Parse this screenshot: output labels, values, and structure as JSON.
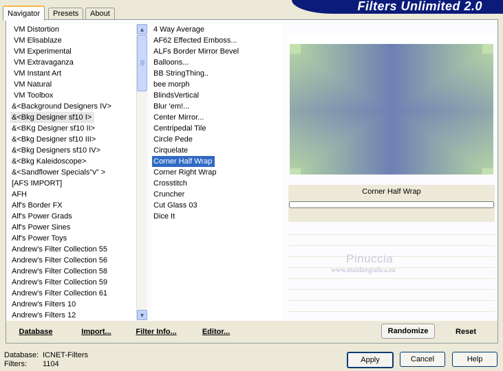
{
  "tabs": [
    {
      "label": "Navigator",
      "active": true
    },
    {
      "label": "Presets",
      "active": false
    },
    {
      "label": "About",
      "active": false
    }
  ],
  "app_title": "Filters Unlimited 2.0",
  "categories": [
    "VM Distortion",
    "VM Elisablaze",
    "VM Experimental",
    "VM Extravaganza",
    "VM Instant Art",
    "VM Natural",
    "VM Toolbox",
    "&<Background Designers IV>",
    "&<Bkg Designer sf10 I>",
    "&<BKg Designer sf10 II>",
    "&<Bkg Designer sf10 III>",
    "&<Bkg Designers sf10 IV>",
    "&<Bkg Kaleidoscope>",
    "&<Sandflower Specials\"v\" >",
    "[AFS IMPORT]",
    "AFH",
    "Alf's Border FX",
    "Alf's Power Grads",
    "Alf's Power Sines",
    "Alf's Power Toys",
    "Andrew's Filter Collection 55",
    "Andrew's Filter Collection 56",
    "Andrew's Filter Collection 58",
    "Andrew's Filter Collection 59",
    "Andrew's Filter Collection 61",
    "Andrew's Filters 10",
    "Andrew's Filters 12"
  ],
  "selected_category": "&<Bkg Designer sf10 I>",
  "filters": [
    "4 Way Average",
    "AF62 Effected Emboss...",
    "ALFs Border Mirror Bevel",
    "Balloons...",
    "BB StringThing..",
    "bee morph",
    "BlindsVertical",
    "Blur 'em!...",
    "Center Mirror...",
    "Centripedal Tile",
    "Circle Pede",
    "Cirquelate",
    "Corner Half Wrap",
    "Corner Right Wrap",
    "Crosstitch",
    "Cruncher",
    "Cut Glass 03",
    "Dice It"
  ],
  "selected_filter": "Corner Half Wrap",
  "preview_caption": "Corner Half Wrap",
  "watermark": {
    "name": "Pinuccia",
    "url": "www.maidiregrafica.eu"
  },
  "toolbar": {
    "database": "Database",
    "import": "Import...",
    "filter_info": "Filter Info...",
    "editor": "Editor...",
    "randomize": "Randomize",
    "reset": "Reset"
  },
  "footer": {
    "database_label": "Database:",
    "database_value": "ICNET-Filters",
    "filters_label": "Filters:",
    "filters_value": "1104",
    "apply": "Apply",
    "cancel": "Cancel",
    "help": "Help"
  },
  "colors": {
    "banner": "#0b1b7a",
    "selection": "#316ac5",
    "preview_green": "#b5d6a2",
    "preview_blue": "#6f7fb4"
  }
}
